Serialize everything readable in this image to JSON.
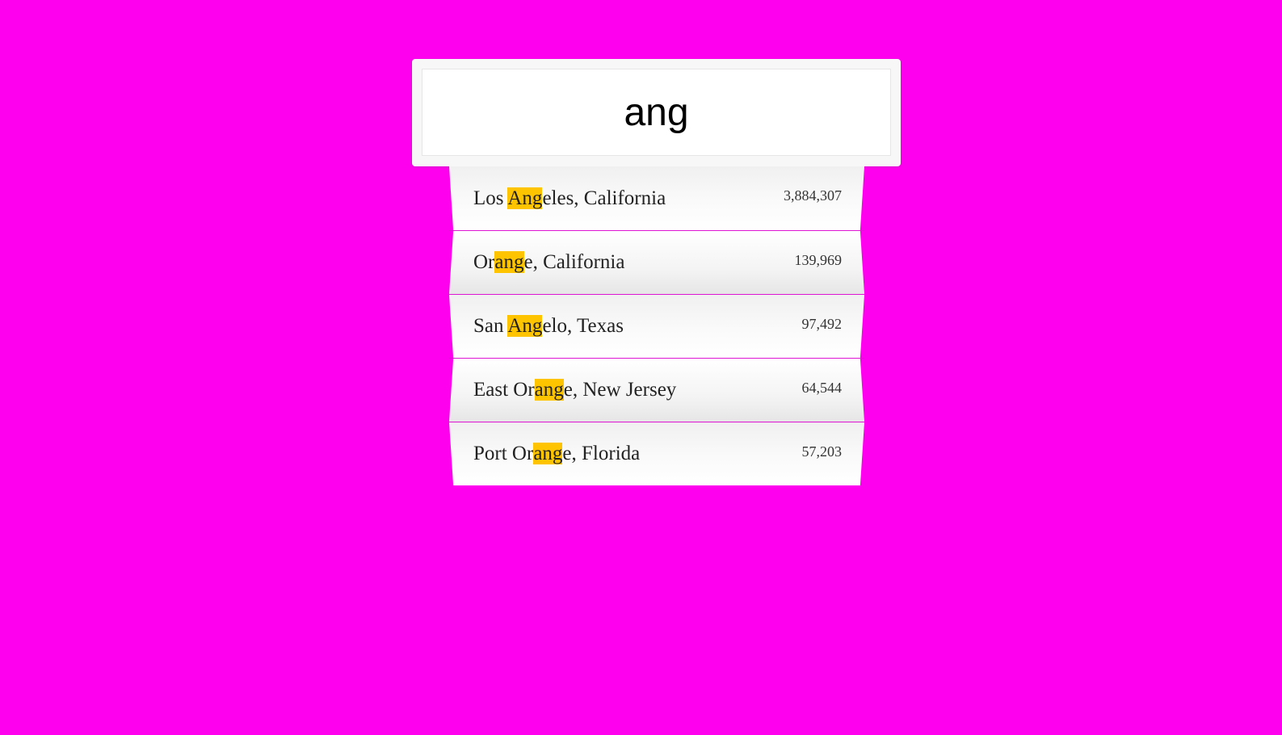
{
  "search": {
    "value": "ang"
  },
  "colors": {
    "background": "#ff00ee",
    "highlight": "#ffc400"
  },
  "suggestions": [
    {
      "name_before": "Los ",
      "match": "Ang",
      "name_after": "eles, California",
      "population": "3,884,307"
    },
    {
      "name_before": "Or",
      "match": "ang",
      "name_after": "e, California",
      "population": "139,969"
    },
    {
      "name_before": "San ",
      "match": "Ang",
      "name_after": "elo, Texas",
      "population": "97,492"
    },
    {
      "name_before": "East Or",
      "match": "ang",
      "name_after": "e, New Jersey",
      "population": "64,544"
    },
    {
      "name_before": "Port Or",
      "match": "ang",
      "name_after": "e, Florida",
      "population": "57,203"
    }
  ]
}
